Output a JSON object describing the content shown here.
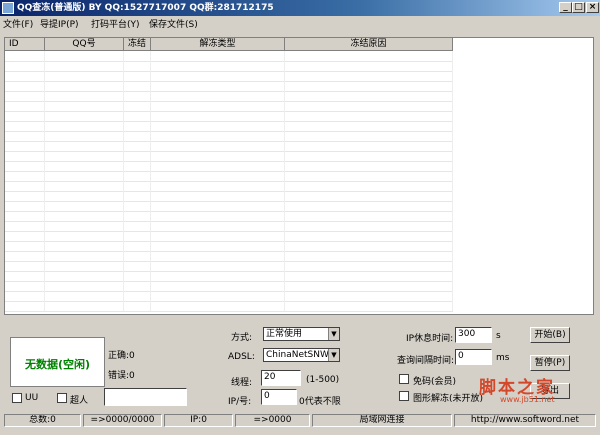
{
  "window": {
    "title": "QQ查冻(普通版) BY QQ:1527717007 QQ群:281712175",
    "min_glyph": "_",
    "max_glyph": "□",
    "close_glyph": "×"
  },
  "menu": [
    {
      "label": "文件(F)"
    },
    {
      "label": "导提IP(P)"
    },
    {
      "label": "打码平台(Y)"
    },
    {
      "label": "保存文件(S)"
    }
  ],
  "grid": {
    "columns": [
      "ID",
      "QQ号",
      "冻结",
      "解冻类型",
      "冻结原因"
    ],
    "rows": []
  },
  "status_panel": {
    "text": "无数据(空闲)"
  },
  "stats": {
    "correct_label": "正确:0",
    "error_label": "错误:0"
  },
  "checks": {
    "uu_label": "UU",
    "chaoren_label": "超人"
  },
  "extra_input": {
    "value": ""
  },
  "form": {
    "mode_label": "方式:",
    "mode_value": "正常使用",
    "adsl_label": "ADSL:",
    "adsl_value": "ChinaNetSNWid",
    "threads_label": "线程:",
    "threads_value": "20",
    "threads_hint": "(1-500)",
    "ip_per_qq_label": "IP/号:",
    "ip_per_qq_value": "0",
    "ip_per_qq_hint": "0代表不限",
    "ip_rest_label": "IP休息时间:",
    "ip_rest_value": "300",
    "ip_rest_unit": "s",
    "query_interval_label": "查询间隔时间:",
    "query_interval_value": "0",
    "query_interval_unit": "ms",
    "free_code_label": "免码(会员)",
    "image_unfreeze_label": "图形解冻(未开放)"
  },
  "buttons": {
    "start": "开始(B)",
    "pause": "暂停(P)",
    "export": "导出"
  },
  "statusbar": {
    "total": "总数:0",
    "progress": "=>0000/0000",
    "ip": "IP:0",
    "ip_arrow": "=>0000",
    "network": "局域网连接",
    "url": "http://www.softword.net"
  },
  "watermark": {
    "text": "脚本之家",
    "url": "www.jb51.net"
  }
}
